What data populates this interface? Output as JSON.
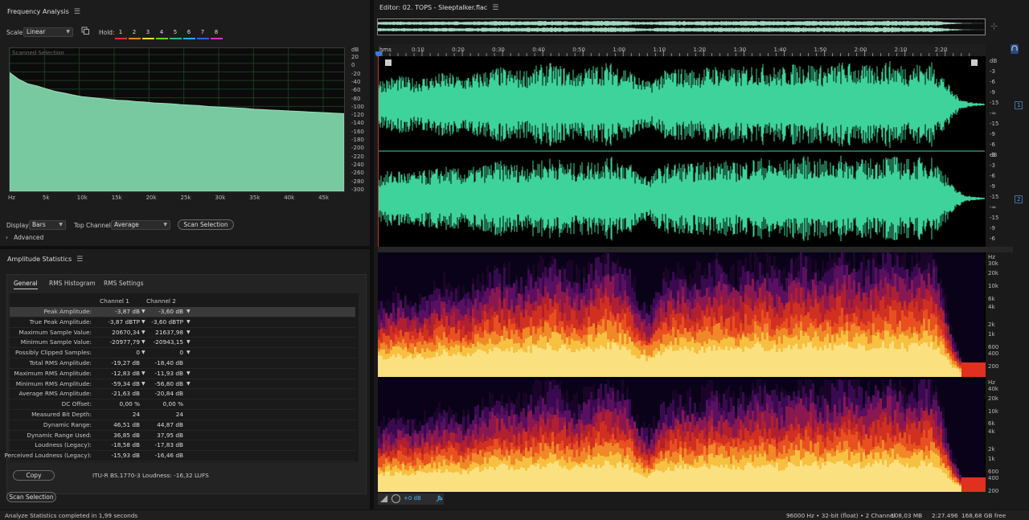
{
  "freq": {
    "title": "Frequency Analysis",
    "scale_label": "Scale:",
    "scale_value": "Linear",
    "hold_label": "Hold:",
    "channels": [
      "1",
      "2",
      "3",
      "4",
      "5",
      "6",
      "7",
      "8"
    ],
    "channel_colors": [
      "#e03030",
      "#f08020",
      "#e8e020",
      "#70d020",
      "#20c080",
      "#20b0e0",
      "#3060f0",
      "#d030d0"
    ],
    "graph_label": "Scanned Selection",
    "y_unit": "dB",
    "y_ticks": [
      "20",
      "0",
      "-20",
      "-40",
      "-60",
      "-80",
      "-100",
      "-120",
      "-140",
      "-160",
      "-180",
      "-200",
      "-220",
      "-240",
      "-260",
      "-280",
      "-300"
    ],
    "x_ticks": [
      "Hz",
      "5k",
      "10k",
      "15k",
      "20k",
      "25k",
      "30k",
      "35k",
      "40k",
      "45k"
    ],
    "display_label": "Display:",
    "display_value": "Bars",
    "top_channel_label": "Top Channel:",
    "top_channel_value": "Average",
    "scan_button": "Scan Selection",
    "advanced_label": "Advanced",
    "curve_db": [
      -20,
      -35,
      -45,
      -50,
      -56,
      -62,
      -66,
      -70,
      -74,
      -76,
      -78,
      -80,
      -82,
      -83,
      -85,
      -86,
      -88,
      -89,
      -90,
      -92,
      -93,
      -94,
      -96,
      -97,
      -98,
      -99,
      -100,
      -102,
      -103,
      -104,
      -105,
      -106,
      -107,
      -108,
      -109,
      -110,
      -111,
      -112
    ]
  },
  "amp": {
    "title": "Amplitude Statistics",
    "tabs": [
      "General",
      "RMS Histogram",
      "RMS Settings"
    ],
    "col1": "Channel 1",
    "col2": "Channel 2",
    "rows": [
      {
        "label": "Peak Amplitude:",
        "c1": "-3,87 dB",
        "c2": "-3,60 dB"
      },
      {
        "label": "True Peak Amplitude:",
        "c1": "-3,87 dBTP",
        "c2": "-3,60 dBTP"
      },
      {
        "label": "Maximum Sample Value:",
        "c1": "20670,34",
        "c2": "21637,98"
      },
      {
        "label": "Minimum Sample Value:",
        "c1": "-20977,79",
        "c2": "-20943,15"
      },
      {
        "label": "Possibly Clipped Samples:",
        "c1": "0",
        "c2": "0"
      },
      {
        "label": "Total RMS Amplitude:",
        "c1": "-19,27 dB",
        "c2": "-18,40 dB"
      },
      {
        "label": "Maximum RMS Amplitude:",
        "c1": "-12,83 dB",
        "c2": "-11,93 dB"
      },
      {
        "label": "Minimum RMS Amplitude:",
        "c1": "-59,34 dB",
        "c2": "-56,80 dB"
      },
      {
        "label": "Average RMS Amplitude:",
        "c1": "-21,63 dB",
        "c2": "-20,84 dB"
      },
      {
        "label": "DC Offset:",
        "c1": "0,00 %",
        "c2": "0,00 %"
      },
      {
        "label": "Measured Bit Depth:",
        "c1": "24",
        "c2": "24"
      },
      {
        "label": "Dynamic Range:",
        "c1": "46,51 dB",
        "c2": "44,87 dB"
      },
      {
        "label": "Dynamic Range Used:",
        "c1": "36,85 dB",
        "c2": "37,95 dB"
      },
      {
        "label": "Loudness (Legacy):",
        "c1": "-18,58 dB",
        "c2": "-17,83 dB"
      },
      {
        "label": "Perceived Loudness (Legacy):",
        "c1": "-15,93 dB",
        "c2": "-16,46 dB"
      }
    ],
    "copy_button": "Copy",
    "loudness_text": "ITU-R BS.1770-3 Loudness: -16,32 LUFS",
    "scan_button": "Scan Selection"
  },
  "editor": {
    "title": "Editor: 02. TOPS - Sleeptalker.flac",
    "time_unit": "hms",
    "time_ticks": [
      "0:10",
      "0:20",
      "0:30",
      "0:40",
      "0:50",
      "1:00",
      "1:10",
      "1:20",
      "1:30",
      "1:40",
      "1:50",
      "2:00",
      "2:10",
      "2:20"
    ],
    "db_scale": [
      "dB",
      "-3",
      "-6",
      "-9",
      "-15",
      "-∞",
      "-15",
      "-9",
      "-6",
      "-3"
    ],
    "ch1_label": "1",
    "ch2_label": "2",
    "hz_scale": [
      "Hz",
      "30k",
      "20k",
      "10k",
      "6k",
      "4k",
      "2k",
      "1k",
      "600",
      "400",
      "200"
    ],
    "hz_scale2": [
      "Hz",
      "40k",
      "20k",
      "10k",
      "6k",
      "4k",
      "2k",
      "1k",
      "600",
      "400",
      "200"
    ],
    "volume": "+0 dB",
    "waveform_color": "#3ed39a",
    "envelope": [
      0.55,
      0.6,
      0.62,
      0.58,
      0.6,
      0.64,
      0.7,
      0.66,
      0.62,
      0.7,
      0.75,
      0.82,
      0.78,
      0.74,
      0.8,
      0.86,
      0.9,
      0.84,
      0.76,
      0.8,
      0.86,
      0.92,
      0.88,
      0.82,
      0.6,
      0.5,
      0.7,
      0.78,
      0.8,
      0.76,
      0.8,
      0.86,
      0.82,
      0.78,
      0.84,
      0.9,
      0.86,
      0.8,
      0.86,
      0.92,
      0.9,
      0.84,
      0.88,
      0.94,
      0.88,
      0.84,
      0.9,
      0.95,
      0.9,
      0.86,
      0.9,
      0.94,
      0.7,
      0.3,
      0.1,
      0.04,
      0.02
    ]
  },
  "status": {
    "left": "Analyze Statistics completed in 1,99 seconds",
    "sample_rate": "96000 Hz • 32-bit (float) • 2 Channel",
    "size": "108,03 MB",
    "duration": "2:27.496",
    "free": "168,68 GB free"
  }
}
